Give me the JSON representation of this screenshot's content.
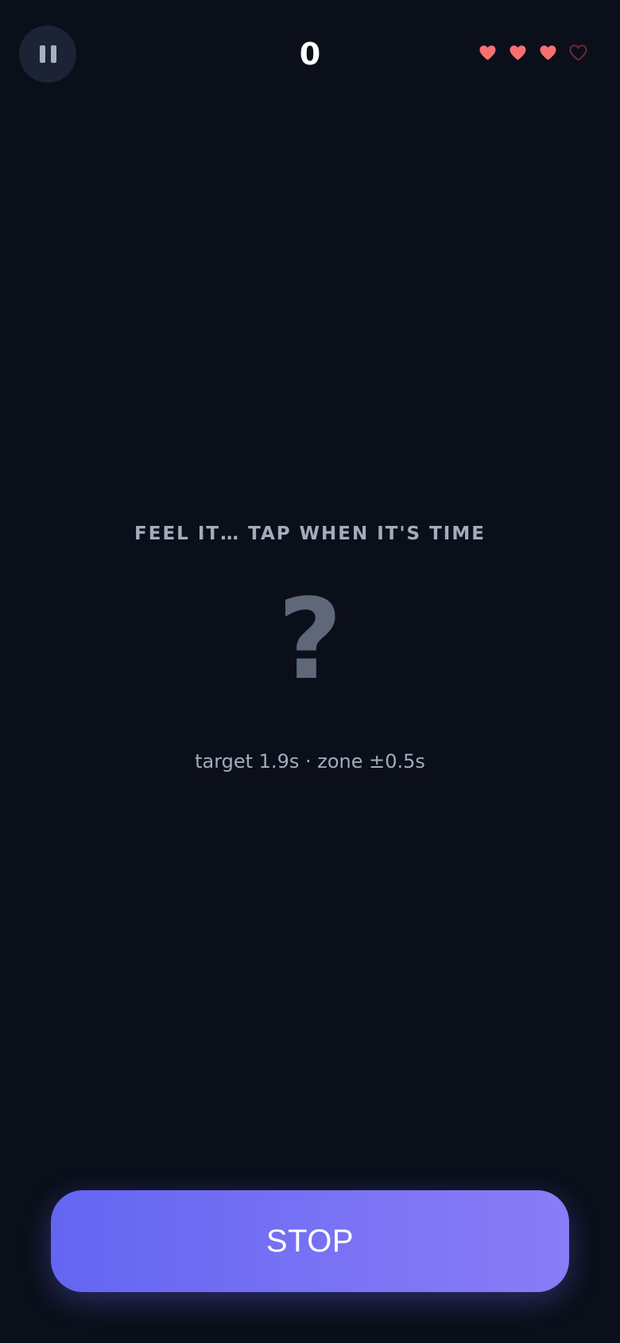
{
  "hud": {
    "score": "0",
    "lives": [
      {
        "state": "full",
        "icon": "heart-full-icon"
      },
      {
        "state": "full",
        "icon": "heart-full-icon"
      },
      {
        "state": "full",
        "icon": "heart-full-icon"
      },
      {
        "state": "empty",
        "icon": "heart-empty-icon"
      }
    ],
    "lives_remaining": 3,
    "lives_max": 4,
    "pause_icon": "pause-icon"
  },
  "main": {
    "prompt": "FEEL IT… TAP WHEN IT'S TIME",
    "mystery": "?",
    "target_info": "target 1.9s · zone ±0.5s"
  },
  "action": {
    "stop_label": "STOP"
  },
  "colors": {
    "background": "#0b0f1a",
    "heart_full": "#f87171",
    "heart_empty": "#6b2a33",
    "button_start": "#6366f1",
    "button_end": "#8b7cf7"
  }
}
